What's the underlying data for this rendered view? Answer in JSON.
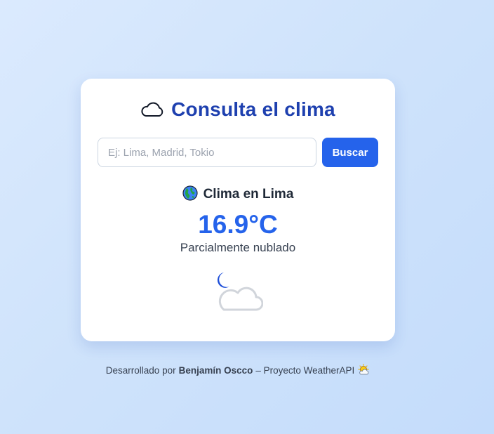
{
  "card": {
    "title": "Consulta el clima",
    "title_icon": "cloud-outline-icon"
  },
  "search": {
    "placeholder": "Ej: Lima, Madrid, Tokio",
    "value": "",
    "button_label": "Buscar"
  },
  "result": {
    "location_icon": "globe-americas-icon",
    "location_text": "Clima en Lima",
    "temperature": "16.9°C",
    "condition": "Parcialmente nublado",
    "condition_icon": "moon-cloud-icon"
  },
  "footer": {
    "prefix": "Desarrollado por",
    "author": "Benjamín Oscco",
    "suffix": "– Proyecto WeatherAPI",
    "icon": "sun-behind-cloud-icon"
  },
  "colors": {
    "accent": "#2563eb",
    "title": "#1e40af",
    "background": "#dbeafe"
  }
}
